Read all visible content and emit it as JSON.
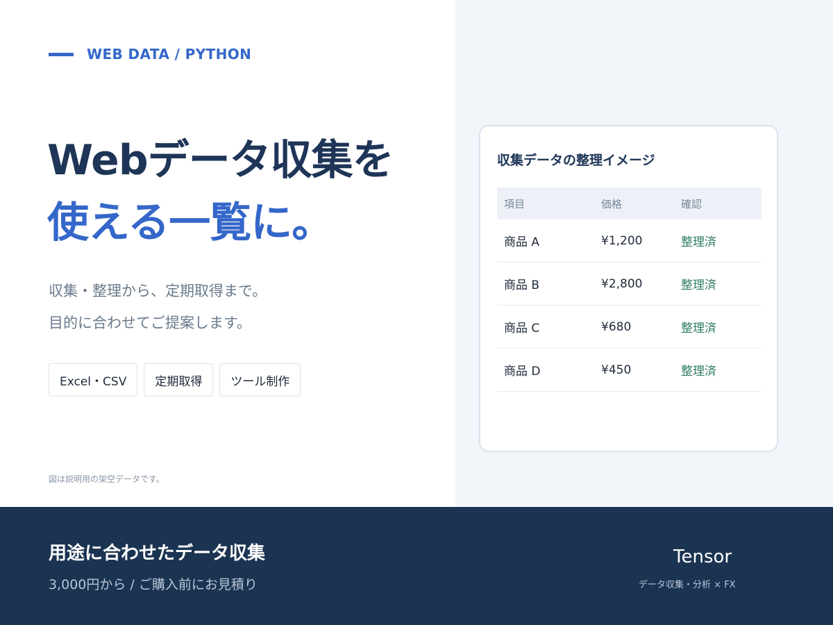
{
  "eyebrow": "WEB DATA / PYTHON",
  "headline": {
    "line1": "Webデータ収集を",
    "line2": "使える一覧に。"
  },
  "lead": {
    "line1": "収集・整理から、定期取得まで。",
    "line2": "目的に合わせてご提案します。"
  },
  "tags": [
    "Excel・CSV",
    "定期取得",
    "ツール制作"
  ],
  "note": "図は説明用の架空データです。",
  "card": {
    "title": "収集データの整理イメージ",
    "headers": [
      "項目",
      "価格",
      "確認"
    ],
    "rows": [
      [
        "商品 A",
        "¥1,200",
        "整理済"
      ],
      [
        "商品 B",
        "¥2,800",
        "整理済"
      ],
      [
        "商品 C",
        "¥680",
        "整理済"
      ],
      [
        "商品 D",
        "¥450",
        "整理済"
      ]
    ]
  },
  "footer": {
    "title": "用途に合わせたデータ収集",
    "subtitle": "3,000円から / ご購入前にお見積り",
    "brand": "Tensor",
    "brand_sub": "データ収集・分析 × FX"
  },
  "colors": {
    "accent": "#3467c9",
    "navy": "#1e3557",
    "footer_bg": "#1b3452",
    "status_green": "#2f7d5e",
    "panel_bg": "#f2f5fa"
  }
}
